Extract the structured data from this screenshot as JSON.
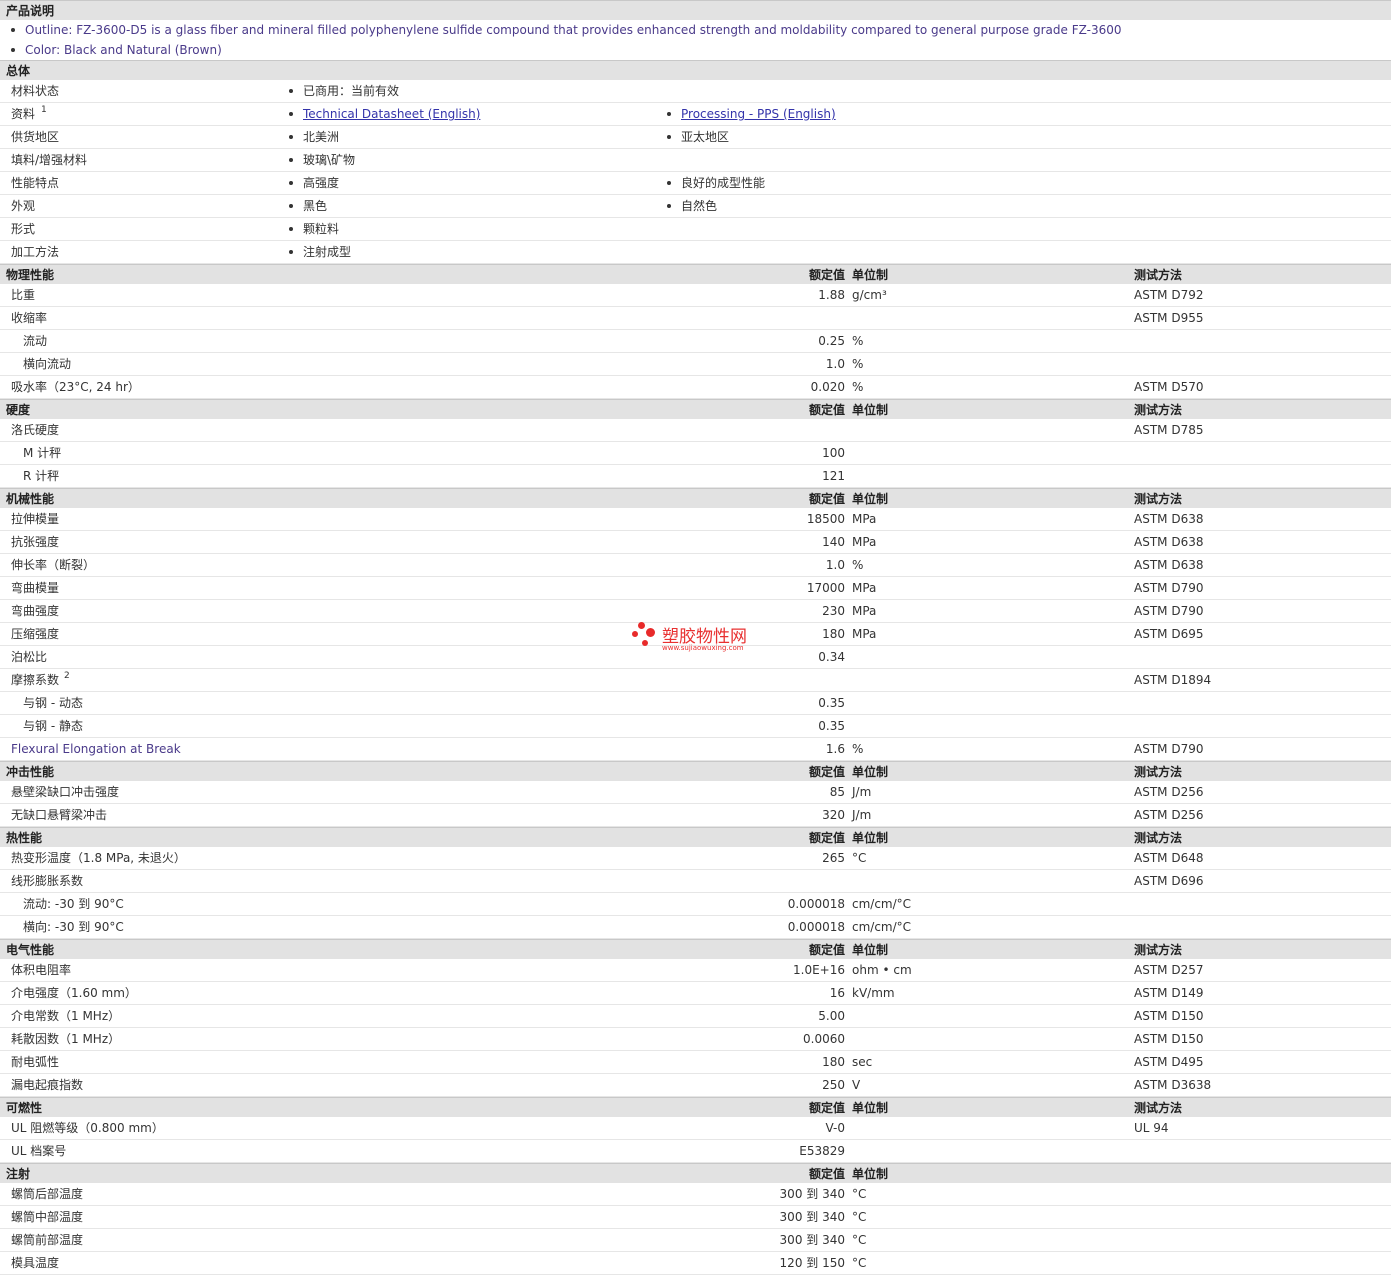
{
  "product": {
    "header": "产品说明",
    "bullets": [
      "Outline: FZ-3600-D5 is a glass fiber and mineral filled polyphenylene sulfide compound that provides enhanced strength and moldability compared to general purpose grade FZ-3600",
      "Color: Black and Natural (Brown)"
    ]
  },
  "general": {
    "header": "总体",
    "rows": [
      {
        "label": "材料状态",
        "v1": "已商用：当前有效",
        "v2": ""
      },
      {
        "label": "资料",
        "sup": "1",
        "v1": "Technical Datasheet (English)",
        "v2": "Processing - PPS (English)"
      },
      {
        "label": "供货地区",
        "v1": "北美洲",
        "v2": "亚太地区"
      },
      {
        "label": "填料/增强材料",
        "v1": "玻璃\\矿物",
        "v2": ""
      },
      {
        "label": "性能特点",
        "v1": "高强度",
        "v2": "良好的成型性能"
      },
      {
        "label": "外观",
        "v1": "黑色",
        "v2": "自然色"
      },
      {
        "label": "形式",
        "v1": "颗粒料",
        "v2": ""
      },
      {
        "label": "加工方法",
        "v1": "注射成型",
        "v2": ""
      }
    ]
  },
  "columns": {
    "value": "额定值",
    "unit": "单位制",
    "method": "测试方法"
  },
  "sections": [
    {
      "title": "物理性能",
      "method_col": true,
      "rows": [
        {
          "label": "比重",
          "value": "1.88",
          "unit": "g/cm³",
          "method": "ASTM D792"
        },
        {
          "label": "收缩率",
          "value": "",
          "unit": "",
          "method": "ASTM D955"
        },
        {
          "label": "流动",
          "indent": true,
          "value": "0.25",
          "unit": "%",
          "method": ""
        },
        {
          "label": "横向流动",
          "indent": true,
          "value": "1.0",
          "unit": "%",
          "method": ""
        },
        {
          "label": "吸水率（23°C, 24 hr）",
          "value": "0.020",
          "unit": "%",
          "method": "ASTM D570"
        }
      ]
    },
    {
      "title": "硬度",
      "method_col": true,
      "rows": [
        {
          "label": "洛氏硬度",
          "value": "",
          "unit": "",
          "method": "ASTM D785"
        },
        {
          "label": "M 计秤",
          "indent": true,
          "value": "100",
          "unit": "",
          "method": ""
        },
        {
          "label": "R 计秤",
          "indent": true,
          "value": "121",
          "unit": "",
          "method": ""
        }
      ]
    },
    {
      "title": "机械性能",
      "method_col": true,
      "rows": [
        {
          "label": "拉伸模量",
          "value": "18500",
          "unit": "MPa",
          "method": "ASTM D638"
        },
        {
          "label": "抗张强度",
          "value": "140",
          "unit": "MPa",
          "method": "ASTM D638"
        },
        {
          "label": "伸长率（断裂）",
          "value": "1.0",
          "unit": "%",
          "method": "ASTM D638"
        },
        {
          "label": "弯曲模量",
          "value": "17000",
          "unit": "MPa",
          "method": "ASTM D790"
        },
        {
          "label": "弯曲强度",
          "value": "230",
          "unit": "MPa",
          "method": "ASTM D790"
        },
        {
          "label": "压缩强度",
          "value": "180",
          "unit": "MPa",
          "method": "ASTM D695"
        },
        {
          "label": "泊松比",
          "value": "0.34",
          "unit": "",
          "method": ""
        },
        {
          "label": "摩擦系数",
          "sup": "2",
          "value": "",
          "unit": "",
          "method": "ASTM D1894"
        },
        {
          "label": "与钢 - 动态",
          "indent": true,
          "value": "0.35",
          "unit": "",
          "method": ""
        },
        {
          "label": "与钢 - 静态",
          "indent": true,
          "value": "0.35",
          "unit": "",
          "method": ""
        },
        {
          "label": "Flexural Elongation at Break",
          "purple": true,
          "value": "1.6",
          "unit": "%",
          "method": "ASTM D790"
        }
      ]
    },
    {
      "title": "冲击性能",
      "method_col": true,
      "rows": [
        {
          "label": "悬壁梁缺口冲击强度",
          "value": "85",
          "unit": "J/m",
          "method": "ASTM D256"
        },
        {
          "label": "无缺口悬臂梁冲击",
          "value": "320",
          "unit": "J/m",
          "method": "ASTM D256"
        }
      ]
    },
    {
      "title": "热性能",
      "method_col": true,
      "rows": [
        {
          "label": "热变形温度（1.8 MPa, 未退火）",
          "value": "265",
          "unit": "°C",
          "method": "ASTM D648"
        },
        {
          "label": "线形膨胀系数",
          "value": "",
          "unit": "",
          "method": "ASTM D696"
        },
        {
          "label": "流动: -30 到 90°C",
          "indent": true,
          "value": "0.000018",
          "unit": "cm/cm/°C",
          "method": ""
        },
        {
          "label": "横向: -30 到 90°C",
          "indent": true,
          "value": "0.000018",
          "unit": "cm/cm/°C",
          "method": ""
        }
      ]
    },
    {
      "title": "电气性能",
      "method_col": true,
      "rows": [
        {
          "label": "体积电阻率",
          "value": "1.0E+16",
          "unit": "ohm • cm",
          "method": "ASTM D257"
        },
        {
          "label": "介电强度（1.60 mm）",
          "value": "16",
          "unit": "kV/mm",
          "method": "ASTM D149"
        },
        {
          "label": "介电常数（1 MHz）",
          "value": "5.00",
          "unit": "",
          "method": "ASTM D150"
        },
        {
          "label": "耗散因数（1 MHz）",
          "value": "0.0060",
          "unit": "",
          "method": "ASTM D150"
        },
        {
          "label": "耐电弧性",
          "value": "180",
          "unit": "sec",
          "method": "ASTM D495"
        },
        {
          "label": "漏电起痕指数",
          "value": "250",
          "unit": "V",
          "method": "ASTM D3638"
        }
      ]
    },
    {
      "title": "可燃性",
      "method_col": true,
      "rows": [
        {
          "label": "UL 阻燃等级（0.800 mm）",
          "value": "V-0",
          "unit": "",
          "method": "UL 94"
        },
        {
          "label": "UL 档案号",
          "value": "E53829",
          "unit": "",
          "method": ""
        }
      ]
    },
    {
      "title": "注射",
      "method_col": false,
      "rows": [
        {
          "label": "螺筒后部温度",
          "value": "300 到 340",
          "unit": "°C",
          "method": ""
        },
        {
          "label": "螺筒中部温度",
          "value": "300 到 340",
          "unit": "°C",
          "method": ""
        },
        {
          "label": "螺筒前部温度",
          "value": "300 到 340",
          "unit": "°C",
          "method": ""
        },
        {
          "label": "模具温度",
          "value": "120 到 150",
          "unit": "°C",
          "method": ""
        }
      ]
    }
  ],
  "watermark": {
    "name": "塑胶物性网",
    "url": "www.sujiaowuxing.com"
  }
}
